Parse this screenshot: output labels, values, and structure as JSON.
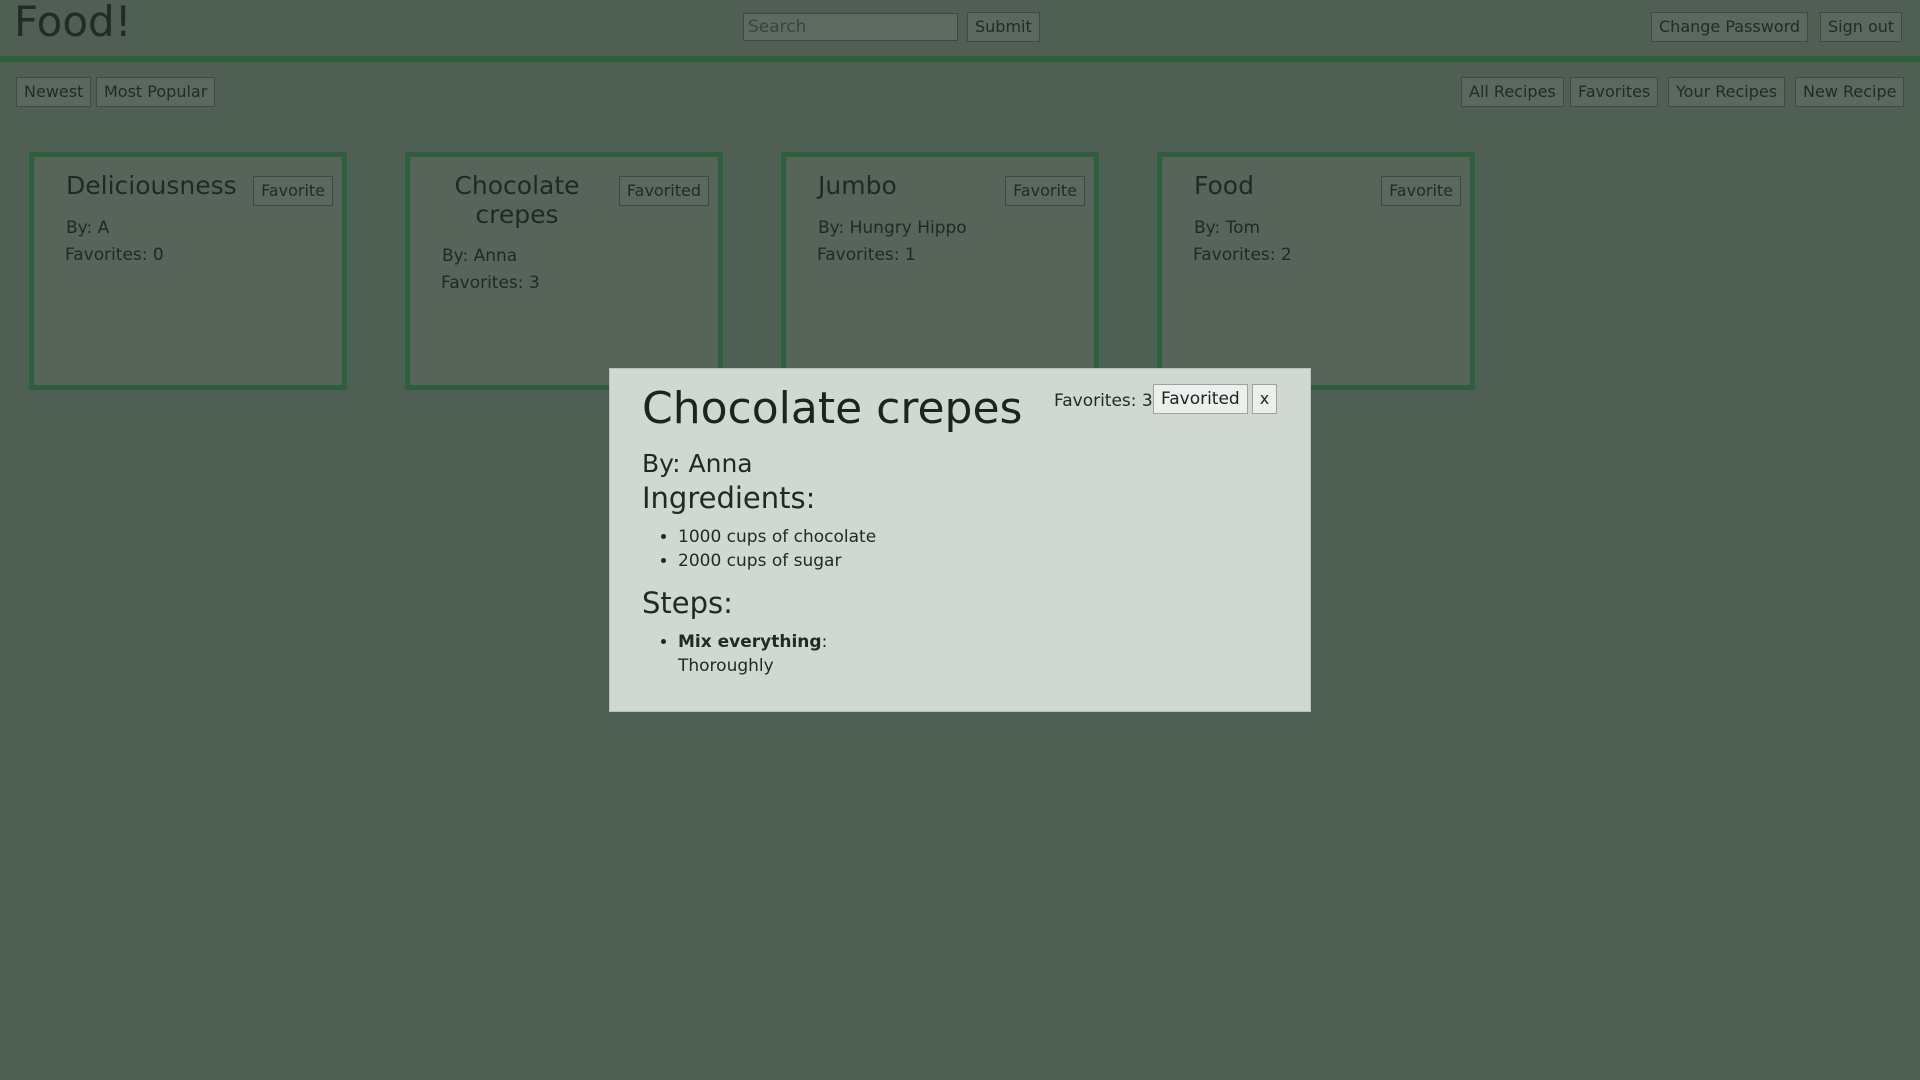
{
  "app": {
    "title": "Food!"
  },
  "header": {
    "search_placeholder": "Search",
    "submit_label": "Submit",
    "change_password_label": "Change Password",
    "sign_out_label": "Sign out"
  },
  "toolbar": {
    "sort": [
      {
        "label": "Newest"
      },
      {
        "label": "Most Popular"
      }
    ],
    "filters": [
      {
        "label": "All Recipes"
      },
      {
        "label": "Favorites"
      },
      {
        "label": "Your Recipes"
      },
      {
        "label": "New Recipe"
      }
    ]
  },
  "recipes": [
    {
      "title": "Deliciousness",
      "by": "By: A",
      "favorites": "Favorites: 0",
      "button": "Favorite"
    },
    {
      "title": "Chocolate crepes",
      "by": "By: Anna",
      "favorites": "Favorites: 3",
      "button": "Favorited"
    },
    {
      "title": "Jumbo",
      "by": "By: Hungry Hippo",
      "favorites": "Favorites: 1",
      "button": "Favorite"
    },
    {
      "title": "Food",
      "by": "By: Tom",
      "favorites": "Favorites: 2",
      "button": "Favorite"
    }
  ],
  "modal": {
    "title": "Chocolate crepes",
    "favorites": "Favorites: 3",
    "favorite_button": "Favorited",
    "close_label": "x",
    "by": "By: Anna",
    "ingredients_heading": "Ingredients:",
    "ingredients": [
      "1000 cups of chocolate",
      "2000 cups of sugar"
    ],
    "steps_heading": "Steps:",
    "steps": [
      {
        "name": "Mix everything",
        "detail": "Thoroughly"
      }
    ]
  }
}
